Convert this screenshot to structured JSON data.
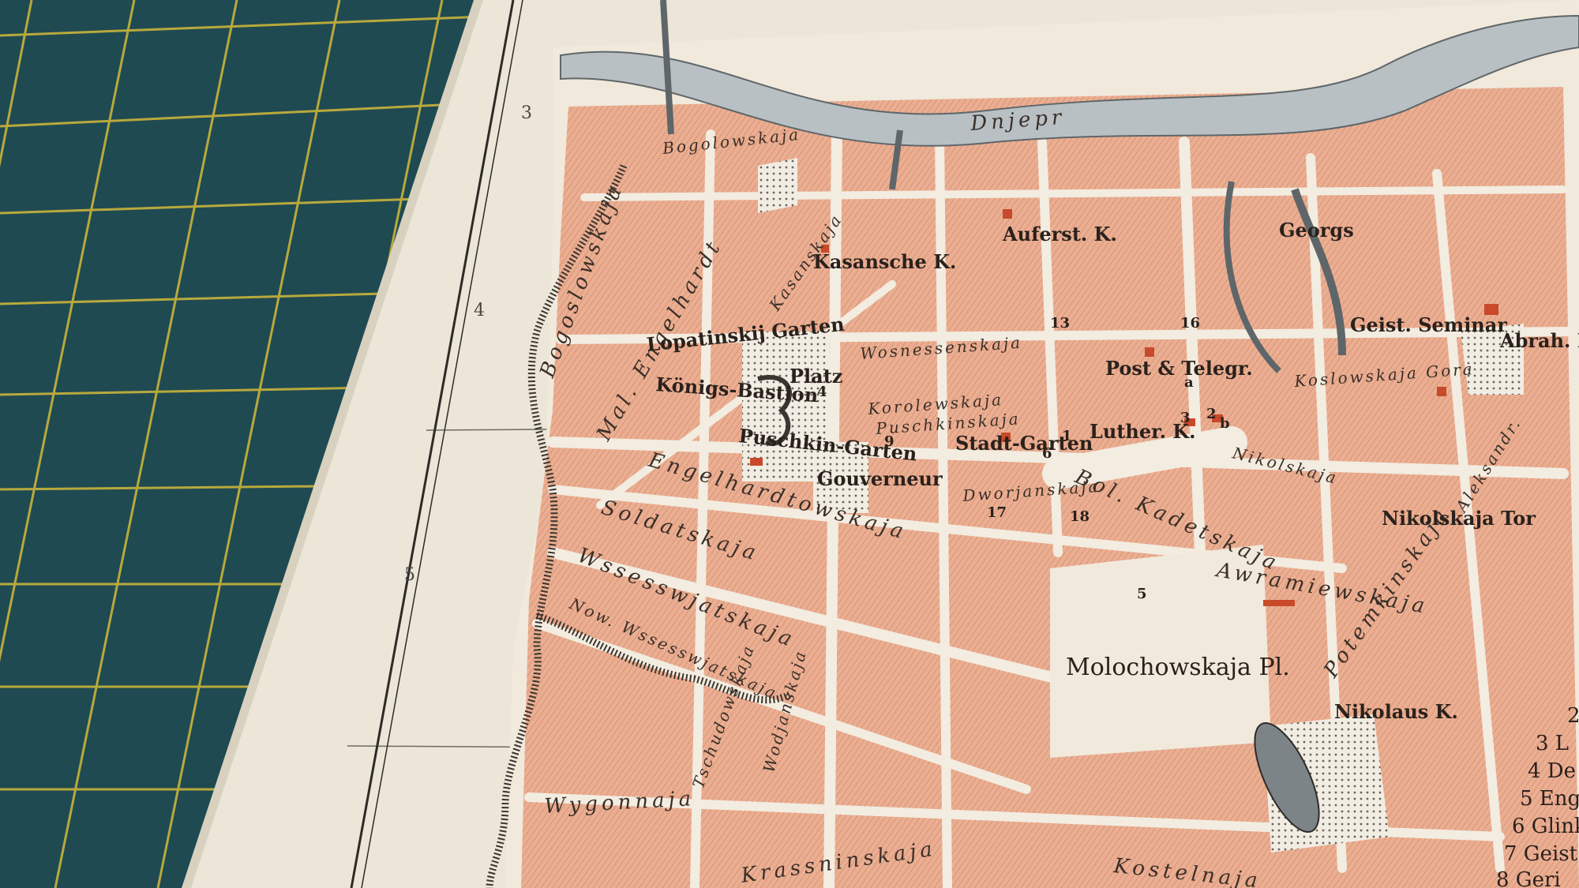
{
  "map": {
    "grid_numbers": [
      "3",
      "4",
      "5"
    ],
    "river_label": "Dnjepr",
    "streets": [
      "Bogoslowskaja",
      "Mal. Engelhardt",
      "Engelhardtowskaja",
      "Soldatskaja",
      "Wssesswjatskaja",
      "Now. Wssesswjatskaja",
      "Tschudowskaja",
      "Wygonnaja",
      "Krassninskaja",
      "Kostelnaja",
      "Wosnessenskaja",
      "Korolewskaja",
      "Puschkinskaja",
      "Dworjanskaja",
      "Bol. Kadetskaja",
      "Nikolskaja",
      "Awramiewskaja",
      "Koslowskaja Gora",
      "Potemkinskaja",
      "Bogolowskaja",
      "Kasanskaja",
      "Wodjanskaja",
      "Aleksandr."
    ],
    "places": [
      "Kasansche K.",
      "Lopatinskij Garten",
      "Platz",
      "Königs-Bastion",
      "Puschkin-Garten",
      "Gouverneur",
      "Stadt-Garten",
      "Post & Telegr.",
      "Luther. K.",
      "Auferst. K.",
      "Molochowskaja Pl.",
      "Nikolaus K.",
      "Nikolskaja Tor",
      "Geist. Seminar",
      "Abrah. Kloster",
      "Georgs"
    ],
    "numbers": [
      "4",
      "9",
      "6",
      "1",
      "17",
      "18",
      "5",
      "13",
      "16",
      "2",
      "3",
      "b",
      "a"
    ],
    "legend": [
      "2",
      "3 L",
      "4 De",
      "5 Eng",
      "6 Glink",
      "7 Geist",
      "8 Geri"
    ]
  },
  "colors": {
    "cutting_mat": "#1f4a52",
    "mat_grid": "#c9b43a",
    "paper": "#ece6d8",
    "blocks": "#e8a98c",
    "river": "#b9c0c3"
  }
}
